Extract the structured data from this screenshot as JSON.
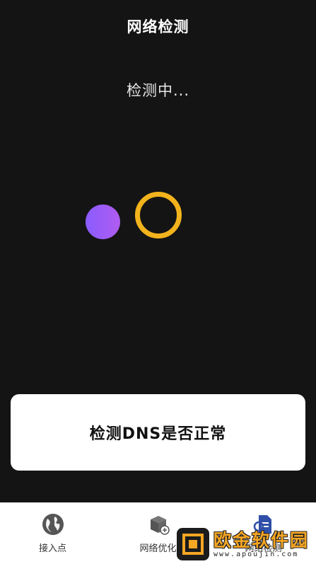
{
  "header": {
    "title": "网络检测"
  },
  "status": {
    "text": "检测中..."
  },
  "colors": {
    "dot": "#9b5cf6",
    "ring": "#f2b31c",
    "background": "#141414"
  },
  "card": {
    "message": "检测DNS是否正常"
  },
  "tabs": [
    {
      "label": "接入点",
      "icon": "globe-icon"
    },
    {
      "label": "网络优化",
      "icon": "network-box-icon"
    },
    {
      "label": "网络检测",
      "icon": "document-search-icon"
    }
  ],
  "watermark": {
    "title": "欧金软件园",
    "url": "www.apoujin.com"
  }
}
